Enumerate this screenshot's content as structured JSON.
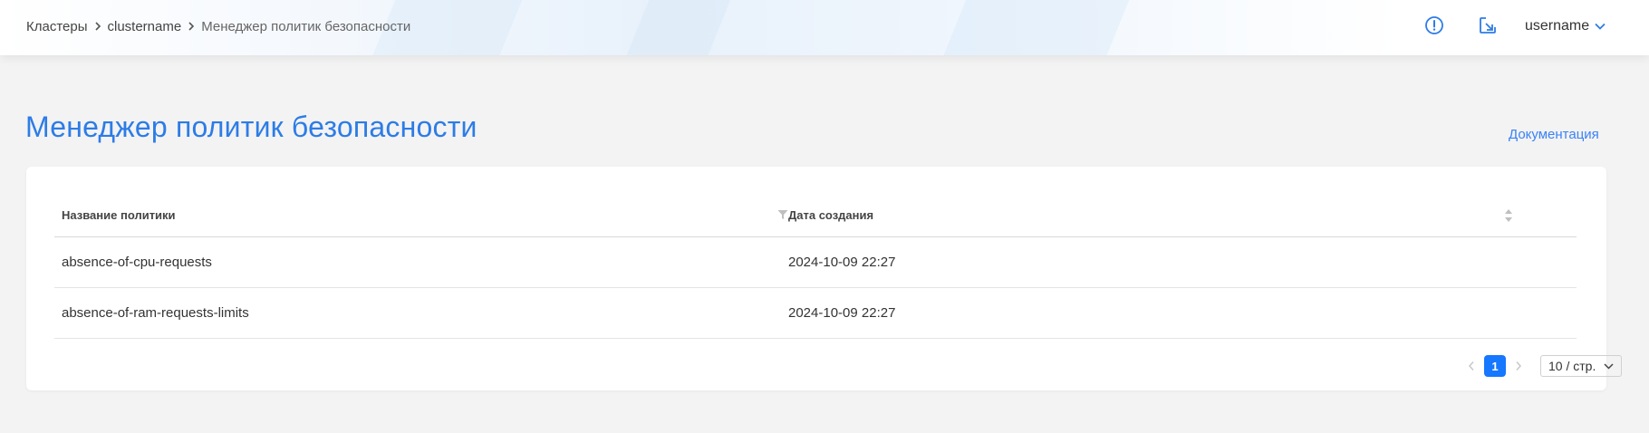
{
  "breadcrumb": {
    "items": [
      "Кластеры",
      "clustername",
      "Менеджер политик безопасности"
    ]
  },
  "header": {
    "username": "username",
    "icons": [
      "alert-circle-icon",
      "logout-icon",
      "chevron-down-icon"
    ]
  },
  "page": {
    "title": "Менеджер политик безопасности",
    "doc_link": "Документация"
  },
  "table": {
    "columns": [
      "Название политики",
      "Дата создания"
    ],
    "rows": [
      {
        "name": "absence-of-cpu-requests",
        "created": "2024-10-09 22:27"
      },
      {
        "name": "absence-of-ram-requests-limits",
        "created": "2024-10-09 22:27"
      }
    ]
  },
  "pagination": {
    "current_page": "1",
    "page_size": "10 / стр."
  },
  "colors": {
    "accent": "#2d7ce6",
    "link": "#3b82f6",
    "page_active": "#1677ff",
    "background": "#f3f3f3"
  }
}
